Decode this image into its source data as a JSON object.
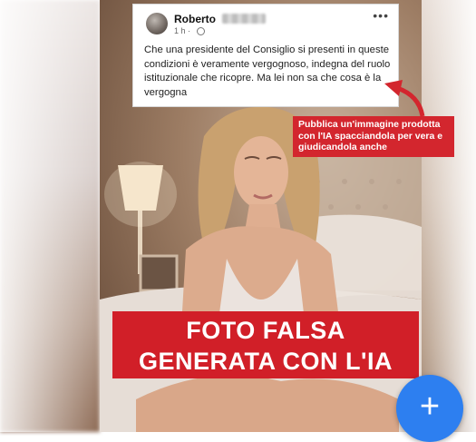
{
  "post": {
    "author": "Roberto",
    "time": "1 h ·",
    "menu_icon": "ellipsis-icon",
    "text": "Che una presidente del Consiglio  si presenti in queste condizioni è veramente vergognoso, indegna del ruolo istituzionale che ricopre. Ma lei non sa che cosa è la vergogna"
  },
  "callout": {
    "text": "Pubblica un'immagine prodotta con l'IA spacciandola per vera e giudicandola anche"
  },
  "banner": {
    "line1": "FOTO FALSA",
    "line2": "GENERATA CON L'IA"
  },
  "fab": {
    "label": "+",
    "icon": "plus-icon"
  },
  "colors": {
    "accent_red": "#d11f28",
    "fab_blue": "#2d7ff0"
  }
}
